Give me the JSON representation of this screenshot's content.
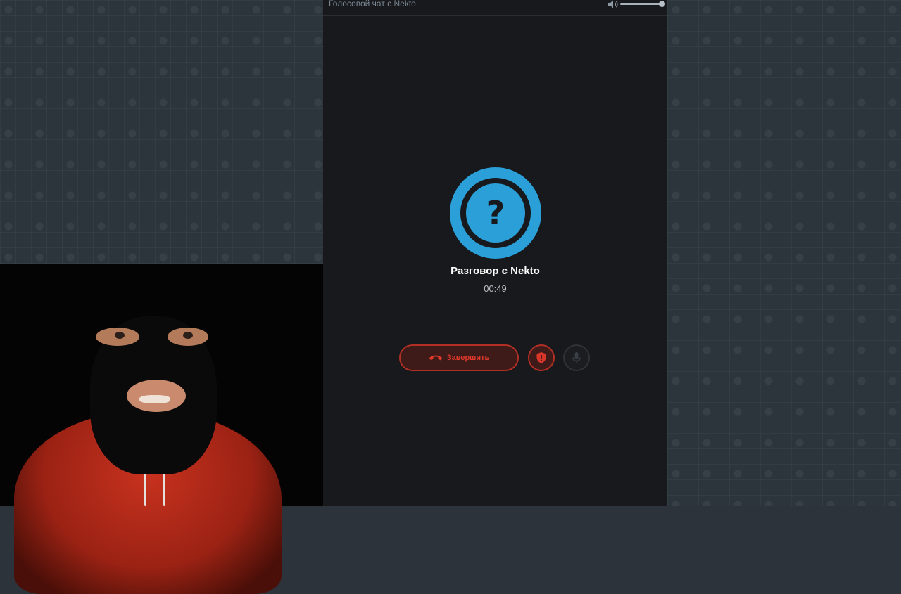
{
  "header": {
    "title": "Голосовой чат с Nekto",
    "volume_level": 1.0
  },
  "call": {
    "avatar_icon": "question-mark-icon",
    "avatar_glyph": "?",
    "title": "Разговор с Nekto",
    "timer": "00:49"
  },
  "controls": {
    "end_label": "Завершить",
    "end_icon": "phone-hangup-icon",
    "shield_icon": "shield-icon",
    "mic_icon": "microphone-icon"
  },
  "colors": {
    "accent": "#2a9fd8",
    "danger": "#e0392c",
    "panel_bg": "#17191d"
  }
}
